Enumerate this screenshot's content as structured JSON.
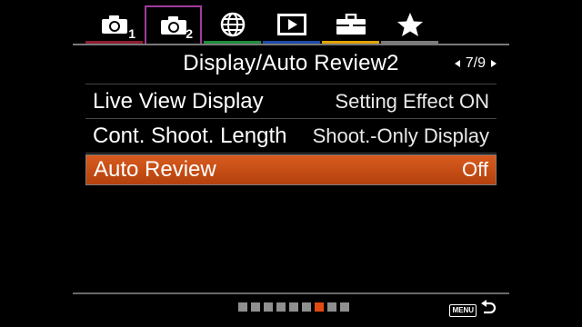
{
  "tabs": [
    {
      "icon": "camera-icon",
      "number": "1",
      "accent": "#8b1c2f",
      "active": false
    },
    {
      "icon": "camera-icon",
      "number": "2",
      "accent": "#a23b9d",
      "active": true
    },
    {
      "icon": "globe-icon",
      "number": "",
      "accent": "#1f8c3b",
      "active": false
    },
    {
      "icon": "play-icon",
      "number": "",
      "accent": "#1d4aa8",
      "active": false
    },
    {
      "icon": "toolbox-icon",
      "number": "",
      "accent": "#e2a200",
      "active": false
    },
    {
      "icon": "star-icon",
      "number": "",
      "accent": "#7b7b7b",
      "active": false
    }
  ],
  "header": {
    "title": "Display/Auto Review2",
    "page": "7/9"
  },
  "menu_items": [
    {
      "label": "Live View Display",
      "value": "Setting Effect ON",
      "selected": false
    },
    {
      "label": "Cont. Shoot. Length",
      "value": "Shoot.-Only Display",
      "selected": false
    },
    {
      "label": "Auto Review",
      "value": "Off",
      "selected": true
    }
  ],
  "pagination": {
    "total": 9,
    "current": 7
  },
  "footer": {
    "menu_label": "MENU"
  },
  "colors": {
    "selected_row": "#c8501a",
    "active_dot": "#e24a12"
  }
}
